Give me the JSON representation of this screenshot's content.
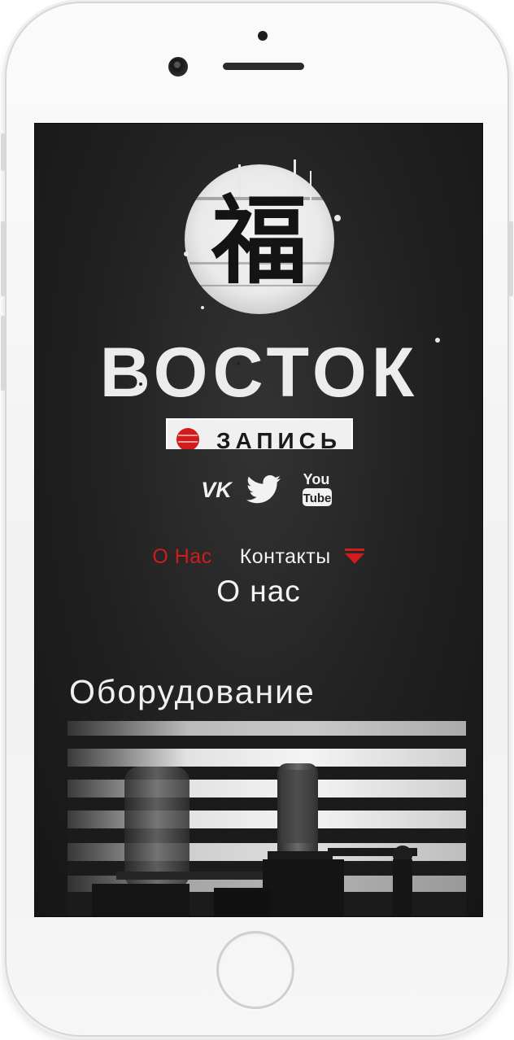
{
  "brand": {
    "kanji": "福",
    "name": "ВОСТОК",
    "subtitle": "ЗАПИСЬ"
  },
  "social": [
    {
      "icon": "vk-icon",
      "label": "VK"
    },
    {
      "icon": "twitter-icon",
      "label": ""
    },
    {
      "icon": "youtube-icon",
      "label_top": "You",
      "label_bottom": "Tube"
    }
  ],
  "nav": {
    "items": [
      {
        "label": "О Нас",
        "active": true
      },
      {
        "label": "Контакты",
        "active": false
      }
    ],
    "dropdown_icon": "triangle-down-icon"
  },
  "section": {
    "title": "О нас",
    "heading": "Оборудование"
  },
  "colors": {
    "accent": "#d11c1c",
    "background": "#1f1f1f",
    "text": "#f2f2f2"
  }
}
